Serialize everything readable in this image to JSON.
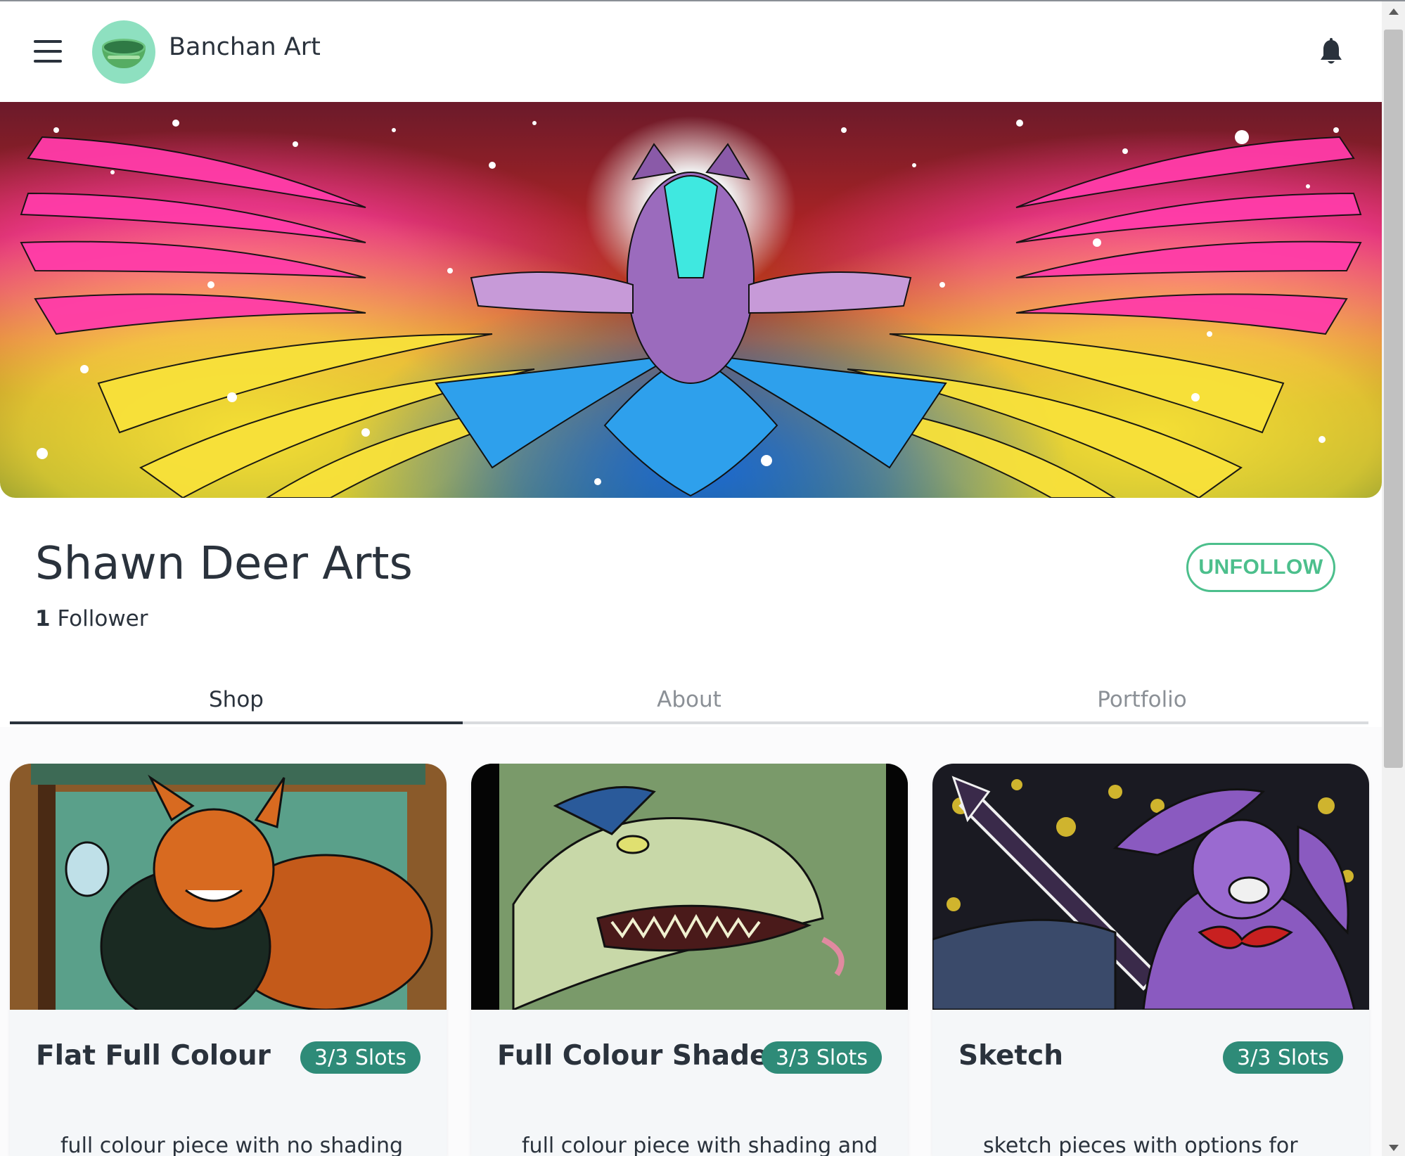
{
  "app": {
    "brand": "Banchan Art"
  },
  "profile": {
    "name": "Shawn Deer Arts",
    "follower_count": "1",
    "follower_label": "Follower",
    "unfollow_label": "UNFOLLOW"
  },
  "tabs": [
    {
      "label": "Shop",
      "active": true
    },
    {
      "label": "About",
      "active": false
    },
    {
      "label": "Portfolio",
      "active": false
    }
  ],
  "offerings": [
    {
      "title": "Flat Full Colour",
      "slots": "3/3 Slots",
      "description": "full colour piece with no shading"
    },
    {
      "title": "Full Colour Shaded",
      "slots": "3/3 Slots",
      "description": "full colour piece with shading and"
    },
    {
      "title": "Sketch",
      "slots": "3/3 Slots",
      "description": "sketch pieces with options for"
    }
  ],
  "icons": {
    "menu": "hamburger-menu-icon",
    "logo": "bowl-logo-icon",
    "notifications": "bell-icon"
  },
  "colors": {
    "accent": "#4cbf8c",
    "slots_badge": "#2e8b78",
    "text": "#2a323c"
  }
}
